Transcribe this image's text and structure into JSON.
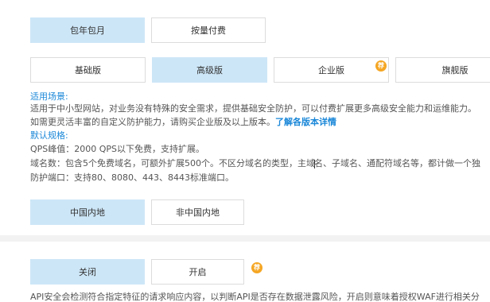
{
  "billing": {
    "options": [
      "包年包月",
      "按量付费"
    ],
    "selected": "包年包月"
  },
  "editions": {
    "options": [
      "基础版",
      "高级版",
      "企业版",
      "旗舰版"
    ],
    "selected": "高级版",
    "badge_text": "荐"
  },
  "description": {
    "scenario_title": "适用场景:",
    "scenario_line1": "适用于中小型网站，对业务没有特殊的安全需求，提供基础安全防护，可以付费扩展更多高级安全能力和运维能力。",
    "scenario_line2_text": "如需更灵活丰富的自定义防护能力，请购买企业版及以上版本。",
    "scenario_line2_link": "了解各版本详情",
    "spec_title": "默认规格:",
    "qps": "QPS峰值：2000 QPS以下免费，支持扩展。",
    "domains_a": "域名数：包含5个免费域名，可额外扩展500个。不区分域名的类型，主域",
    "domains_b": "名、子域名、通配符域名等，都计做一个独",
    "ports": "防护端口：支持80、8080、443、8443标准端口。"
  },
  "region": {
    "options": [
      "中国内地",
      "非中国内地"
    ],
    "selected": "中国内地"
  },
  "api_security": {
    "options": [
      "关闭",
      "开启"
    ],
    "selected": "关闭",
    "badge_text": "荐",
    "description": "API安全会检测符合指定特征的请求响应内容，以判断API是否存在数据泄露风险，开启则意味着授权WAF进行相关分"
  },
  "colors": {
    "selected_bg": "#cde6f7",
    "link": "#1a87d8",
    "badge": "#f5a623"
  }
}
